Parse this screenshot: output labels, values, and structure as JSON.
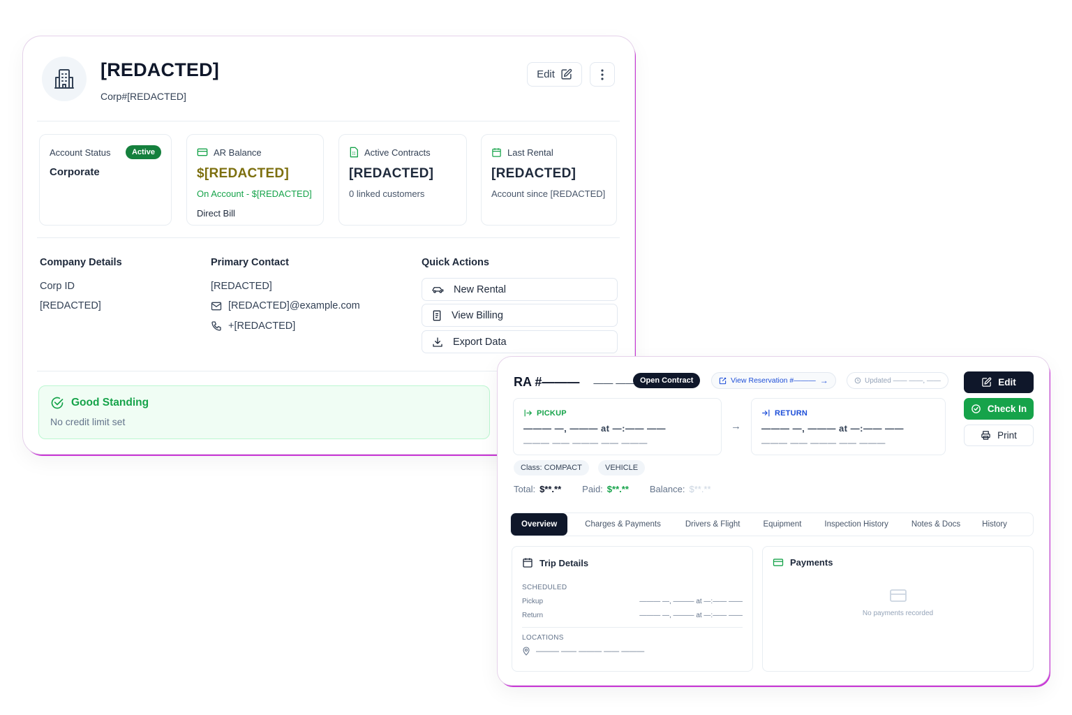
{
  "customer": {
    "name": "[REDACTED]",
    "corp_id_line": "Corp#[REDACTED]",
    "edit_label": "Edit",
    "stats": {
      "account_status": {
        "label": "Account Status",
        "badge": "Active",
        "value": "Corporate"
      },
      "ar_balance": {
        "label": "AR Balance",
        "value": "$[REDACTED]",
        "sub": "On Account - $[REDACTED]",
        "sub2": "Direct Bill"
      },
      "active_contracts": {
        "label": "Active Contracts",
        "value": "[REDACTED]",
        "sub": "0 linked customers"
      },
      "last_rental": {
        "label": "Last Rental",
        "value": "[REDACTED]",
        "sub": "Account since [REDACTED]"
      }
    },
    "company_details": {
      "title": "Company Details",
      "corp_id_label": "Corp ID",
      "corp_id_value": "[REDACTED]"
    },
    "primary_contact": {
      "title": "Primary Contact",
      "name": "[REDACTED]",
      "email": "[REDACTED]@example.com",
      "phone": "+[REDACTED]"
    },
    "quick_actions": {
      "title": "Quick Actions",
      "new_rental": "New Rental",
      "view_billing": "View Billing",
      "export_data": "Export Data"
    },
    "standing": {
      "title": "Good Standing",
      "sub": "No credit limit set"
    },
    "colors": {
      "active_badge": "#15803d",
      "ar_value": "#7c6f0e",
      "on_account": "#16a34a",
      "standing_bg": "#f0fdf4"
    }
  },
  "rental": {
    "ra_label": "RA #———",
    "ra_date": "—— ——",
    "status": "Open Contract",
    "view_reservation": "View Reservation #———",
    "updated": "Updated —— ——, ——",
    "buttons": {
      "edit": "Edit",
      "check_in": "Check In",
      "print": "Print"
    },
    "pickup": {
      "label": "PICKUP",
      "datetime": "——— —, ——— at —:—— ——",
      "location": "——— —— ——— —— ———"
    },
    "return": {
      "label": "RETURN",
      "datetime": "——— —, ——— at —:—— ——",
      "location": "——— —— ——— —— ———"
    },
    "chips": {
      "class": "Class: COMPACT",
      "vehicle": "VEHICLE"
    },
    "totals": {
      "total_label": "Total:",
      "total_value": "$**.**",
      "paid_label": "Paid:",
      "paid_value": "$**.**",
      "balance_label": "Balance:",
      "balance_value": "$**.**"
    },
    "tabs": [
      "Overview",
      "Charges & Payments",
      "Drivers & Flight",
      "Equipment",
      "Inspection History",
      "Notes & Docs",
      "History"
    ],
    "trip": {
      "title": "Trip Details",
      "scheduled": "SCHEDULED",
      "pickup_label": "Pickup",
      "pickup_value": "——— —, ——— at —:—— ——",
      "return_label": "Return",
      "return_value": "——— —, ——— at —:—— ——",
      "locations": "LOCATIONS",
      "location_value": "——— —— ——— —— ———"
    },
    "payments": {
      "title": "Payments",
      "empty": "No payments recorded"
    },
    "colors": {
      "dark": "#0f172a",
      "green": "#16a34a",
      "link": "#1d4ed8"
    }
  }
}
